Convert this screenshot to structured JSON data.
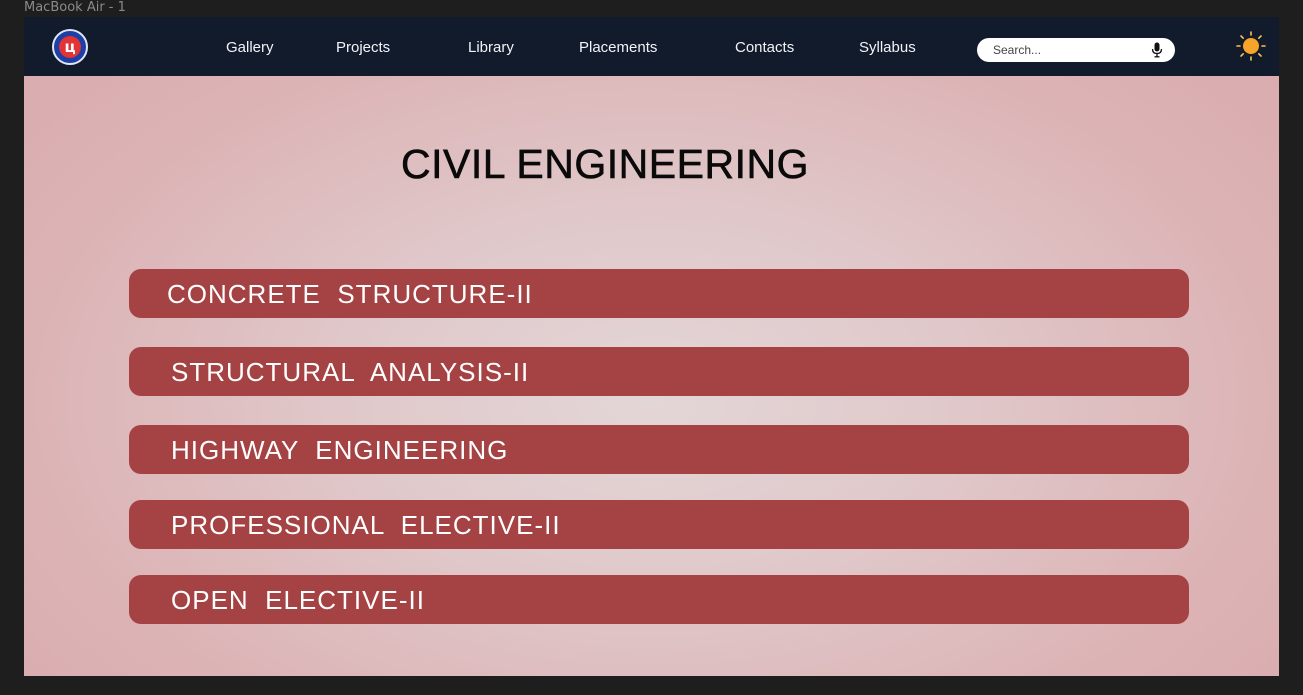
{
  "window": {
    "frame_label": "MacBook Air - 1"
  },
  "nav": {
    "items": [
      {
        "label": "Gallery"
      },
      {
        "label": "Projects"
      },
      {
        "label": "Library"
      },
      {
        "label": "Placements"
      },
      {
        "label": "Contacts"
      },
      {
        "label": "Syllabus"
      }
    ],
    "search_placeholder": "Search...",
    "logo_icon": "college-logo-icon",
    "mic_icon": "microphone-icon",
    "theme_icon": "sun-icon"
  },
  "main": {
    "title": "CIVIL ENGINEERING",
    "subjects": [
      {
        "label": "CONCRETE  STRUCTURE-II"
      },
      {
        "label": "STRUCTURAL  ANALYSIS-II"
      },
      {
        "label": "HIGHWAY  ENGINEERING"
      },
      {
        "label": "PROFESSIONAL  ELECTIVE-II"
      },
      {
        "label": "OPEN  ELECTIVE-II"
      }
    ]
  },
  "colors": {
    "navbar": "#121b2c",
    "subject_bar": "#a54244",
    "background": "#e0c8ca",
    "sun": "#f5a623"
  }
}
